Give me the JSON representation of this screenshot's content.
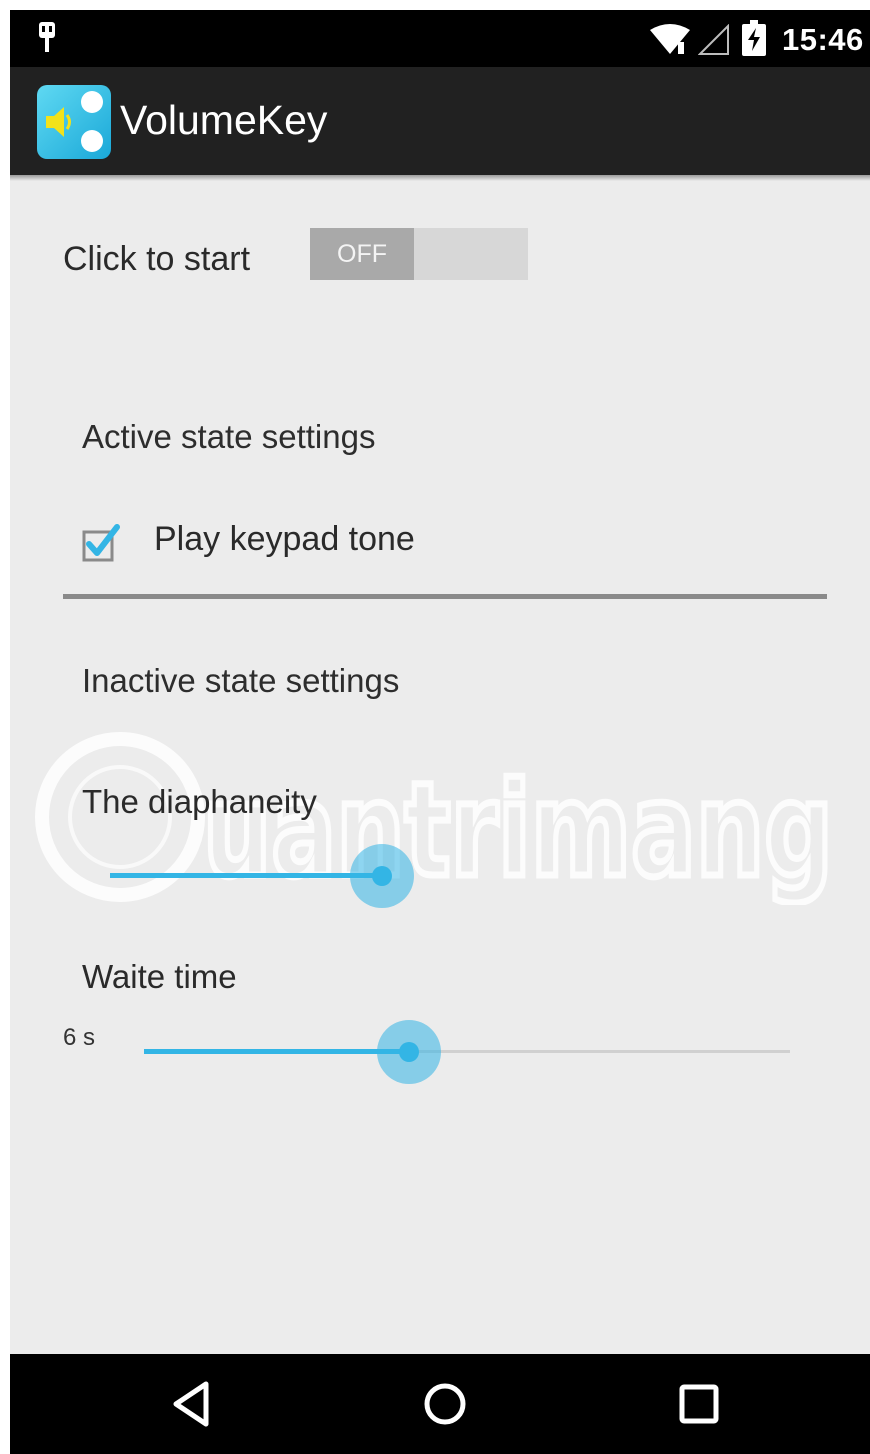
{
  "status_bar": {
    "time": "15:46",
    "icons": [
      "usb-icon",
      "wifi-icon",
      "signal-icon",
      "battery-charging-icon"
    ]
  },
  "action_bar": {
    "app_title": "VolumeKey",
    "app_icon": "volumekey-app-icon"
  },
  "main": {
    "start": {
      "label": "Click to start",
      "toggle_text": "OFF",
      "toggle_on": false
    },
    "active_section": {
      "title": "Active state settings",
      "keypad_tone": {
        "label": "Play keypad tone",
        "checked": true
      }
    },
    "inactive_section": {
      "title": "Inactive state settings",
      "diaphaneity": {
        "label": "The diaphaneity",
        "level_fraction": 0.4
      },
      "wait_time": {
        "label": "Waite time",
        "value": "6 s",
        "level_fraction": 0.41
      }
    }
  },
  "watermark": {
    "text": "uantrimang"
  },
  "nav_bar": {
    "buttons": [
      "back-icon",
      "home-icon",
      "recents-icon"
    ]
  },
  "colors": {
    "accent": "#33b5e5",
    "status_bar": "#000000",
    "action_bar": "#212121",
    "background": "#ececec",
    "toggle_off": "#a9a9a9"
  }
}
